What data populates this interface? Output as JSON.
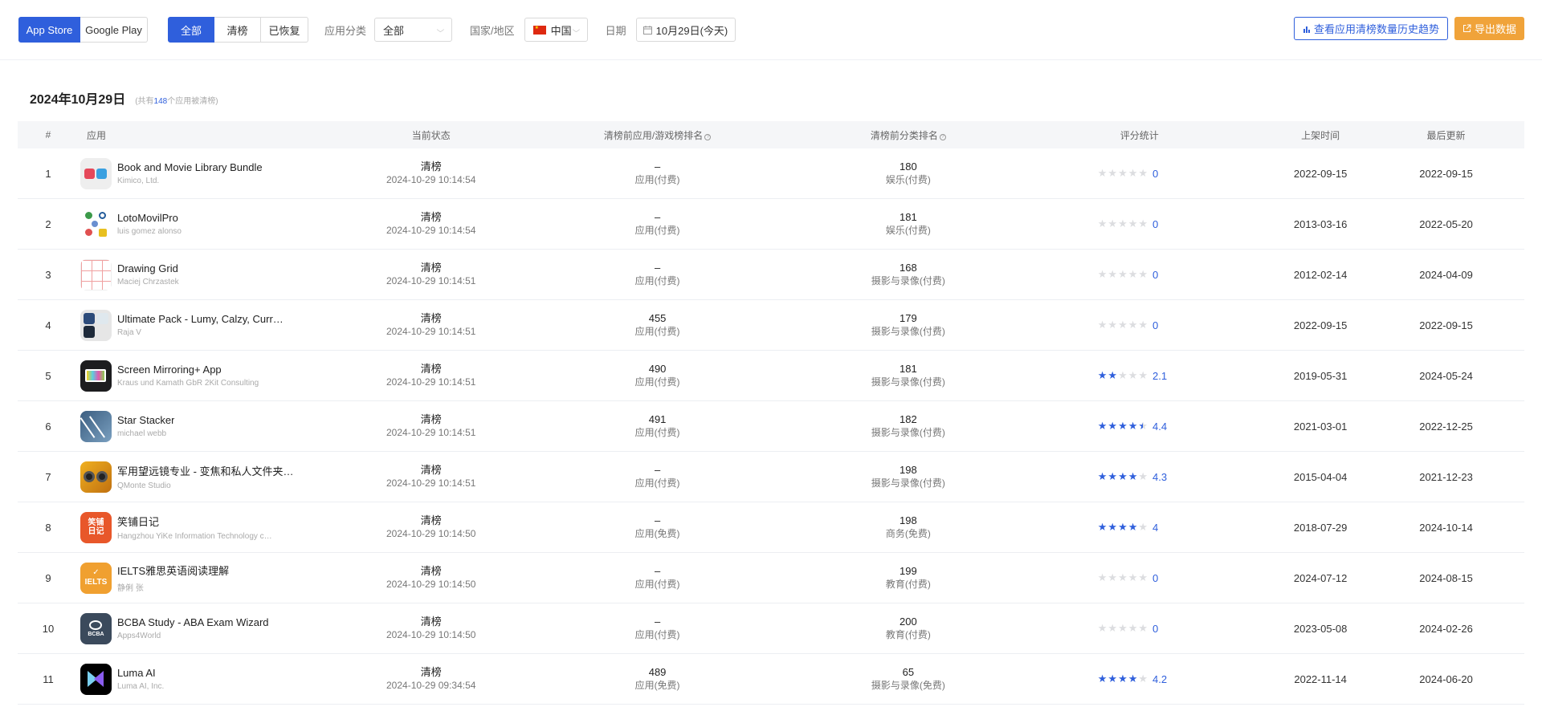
{
  "toolbar": {
    "stores": [
      {
        "label": "App Store",
        "active": true
      },
      {
        "label": "Google Play",
        "active": false
      }
    ],
    "status_tabs": [
      {
        "label": "全部",
        "active": true
      },
      {
        "label": "清榜",
        "active": false
      },
      {
        "label": "已恢复",
        "active": false
      }
    ],
    "category_label": "应用分类",
    "category_value": "全部",
    "region_label": "国家/地区",
    "region_value": "中国",
    "date_label": "日期",
    "date_value": "10月29日(今天)",
    "history_button": "查看应用清榜数量历史趋势",
    "export_button": "导出数据"
  },
  "summary": {
    "date": "2024年10月29日",
    "sub_prefix": "(共有",
    "count": "148",
    "sub_suffix": "个应用被清榜)"
  },
  "columns": {
    "index": "#",
    "app": "应用",
    "status": "当前状态",
    "rank_before": "清榜前应用/游戏榜排名",
    "cat_rank_before": "清榜前分类排名",
    "rating": "评分统计",
    "release": "上架时间",
    "last_update": "最后更新"
  },
  "rows": [
    {
      "idx": "1",
      "name": "Book and Movie Library Bundle",
      "dev": "Kimico, Ltd.",
      "icon": "bundle",
      "status": "清榜",
      "time": "2024-10-29 10:14:54",
      "rank": "–",
      "rank_type": "应用(付费)",
      "cat_rank": "180",
      "cat": "娱乐(付费)",
      "rating": 0,
      "rating_text": "0",
      "release": "2022-09-15",
      "update": "2022-09-15"
    },
    {
      "idx": "2",
      "name": "LotoMovilPro",
      "dev": "luis gomez alonso",
      "icon": "loto",
      "status": "清榜",
      "time": "2024-10-29 10:14:54",
      "rank": "–",
      "rank_type": "应用(付费)",
      "cat_rank": "181",
      "cat": "娱乐(付费)",
      "rating": 0,
      "rating_text": "0",
      "release": "2013-03-16",
      "update": "2022-05-20"
    },
    {
      "idx": "3",
      "name": "Drawing Grid",
      "dev": "Maciej Chrzastek",
      "icon": "grid",
      "status": "清榜",
      "time": "2024-10-29 10:14:51",
      "rank": "–",
      "rank_type": "应用(付费)",
      "cat_rank": "168",
      "cat": "摄影与录像(付费)",
      "rating": 0,
      "rating_text": "0",
      "release": "2012-02-14",
      "update": "2024-04-09"
    },
    {
      "idx": "4",
      "name": "Ultimate Pack - Lumy, Calzy, Curr…",
      "dev": "Raja V",
      "icon": "pack",
      "status": "清榜",
      "time": "2024-10-29 10:14:51",
      "rank": "455",
      "rank_type": "应用(付费)",
      "cat_rank": "179",
      "cat": "摄影与录像(付费)",
      "rating": 0,
      "rating_text": "0",
      "release": "2022-09-15",
      "update": "2022-09-15"
    },
    {
      "idx": "5",
      "name": "Screen Mirroring+ App",
      "dev": "Kraus und Kamath GbR 2Kit Consulting",
      "icon": "mirror",
      "status": "清榜",
      "time": "2024-10-29 10:14:51",
      "rank": "490",
      "rank_type": "应用(付费)",
      "cat_rank": "181",
      "cat": "摄影与录像(付费)",
      "rating": 2.1,
      "rating_text": "2.1",
      "release": "2019-05-31",
      "update": "2024-05-24"
    },
    {
      "idx": "6",
      "name": "Star Stacker",
      "dev": "michael webb",
      "icon": "star",
      "status": "清榜",
      "time": "2024-10-29 10:14:51",
      "rank": "491",
      "rank_type": "应用(付费)",
      "cat_rank": "182",
      "cat": "摄影与录像(付费)",
      "rating": 4.4,
      "rating_text": "4.4",
      "release": "2021-03-01",
      "update": "2022-12-25"
    },
    {
      "idx": "7",
      "name": "军用望远镜专业 - 变焦和私人文件夹…",
      "dev": "QMonte Studio",
      "icon": "binoc",
      "status": "清榜",
      "time": "2024-10-29 10:14:51",
      "rank": "–",
      "rank_type": "应用(付费)",
      "cat_rank": "198",
      "cat": "摄影与录像(付费)",
      "rating": 4.3,
      "rating_text": "4.3",
      "release": "2015-04-04",
      "update": "2021-12-23"
    },
    {
      "idx": "8",
      "name": "笑铺日记",
      "dev": "Hangzhou YiKe Information Technology c…",
      "icon": "diary",
      "status": "清榜",
      "time": "2024-10-29 10:14:50",
      "rank": "–",
      "rank_type": "应用(免费)",
      "cat_rank": "198",
      "cat": "商务(免费)",
      "rating": 4,
      "rating_text": "4",
      "release": "2018-07-29",
      "update": "2024-10-14"
    },
    {
      "idx": "9",
      "name": "IELTS雅思英语阅读理解",
      "dev": "静俐 张",
      "icon": "ielts",
      "status": "清榜",
      "time": "2024-10-29 10:14:50",
      "rank": "–",
      "rank_type": "应用(付费)",
      "cat_rank": "199",
      "cat": "教育(付费)",
      "rating": 0,
      "rating_text": "0",
      "release": "2024-07-12",
      "update": "2024-08-15"
    },
    {
      "idx": "10",
      "name": "BCBA Study - ABA Exam Wizard",
      "dev": "Apps4World",
      "icon": "bcba",
      "status": "清榜",
      "time": "2024-10-29 10:14:50",
      "rank": "–",
      "rank_type": "应用(付费)",
      "cat_rank": "200",
      "cat": "教育(付费)",
      "rating": 0,
      "rating_text": "0",
      "release": "2023-05-08",
      "update": "2024-02-26"
    },
    {
      "idx": "11",
      "name": "Luma AI",
      "dev": "Luma AI, Inc.",
      "icon": "luma",
      "status": "清榜",
      "time": "2024-10-29 09:34:54",
      "rank": "489",
      "rank_type": "应用(免费)",
      "cat_rank": "65",
      "cat": "摄影与录像(免费)",
      "rating": 4.2,
      "rating_text": "4.2",
      "release": "2022-11-14",
      "update": "2024-06-20"
    }
  ],
  "colors": {
    "accent": "#2f5fdc",
    "export": "#f0a33a",
    "star_off": "#dcdde0"
  },
  "icons": {
    "info": "info-icon",
    "calendar": "calendar-icon",
    "chart": "bar-chart-icon",
    "export": "export-icon",
    "chevron": "chevron-down-icon",
    "flag": "china-flag-icon"
  }
}
